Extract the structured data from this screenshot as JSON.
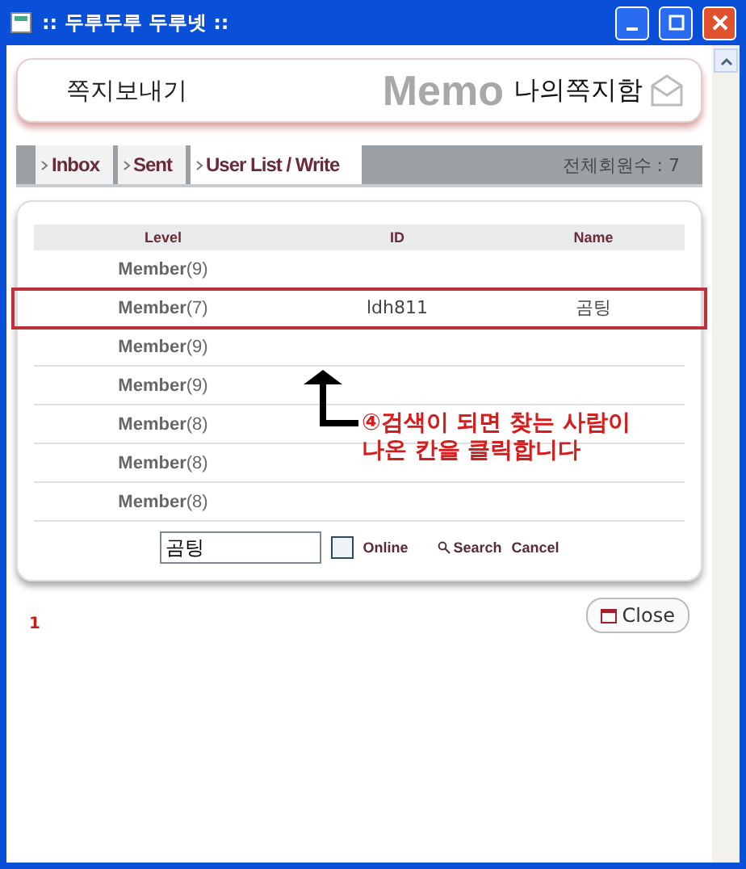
{
  "window": {
    "title": ":: 두루두루 두루넷 ::"
  },
  "header": {
    "left": "쪽지보내기",
    "right": "나의쪽지함",
    "logo": "Memo"
  },
  "tabs": [
    {
      "label": "Inbox",
      "selected": false
    },
    {
      "label": "Sent",
      "selected": false
    },
    {
      "label": "User List / Write",
      "selected": true
    }
  ],
  "member_count": "전체회원수 : 7",
  "table": {
    "columns": [
      "Level",
      "ID",
      "Name"
    ],
    "rows": [
      {
        "level": "Member",
        "num": "(9)",
        "id": "",
        "name": "",
        "selected": false
      },
      {
        "level": "Member",
        "num": "(7)",
        "id": "ldh811",
        "name": "곰팅",
        "selected": true
      },
      {
        "level": "Member",
        "num": "(9)",
        "id": "",
        "name": "",
        "selected": false
      },
      {
        "level": "Member",
        "num": "(9)",
        "id": "",
        "name": "",
        "selected": false
      },
      {
        "level": "Member",
        "num": "(8)",
        "id": "",
        "name": "",
        "selected": false
      },
      {
        "level": "Member",
        "num": "(8)",
        "id": "",
        "name": "",
        "selected": false
      },
      {
        "level": "Member",
        "num": "(8)",
        "id": "",
        "name": "",
        "selected": false
      }
    ]
  },
  "search": {
    "value": "곰팅",
    "online": {
      "label": "Online",
      "checked": false
    },
    "search_label": "Search",
    "cancel_label": "Cancel"
  },
  "pager": {
    "pages": [
      {
        "label": "1",
        "selected": true
      }
    ]
  },
  "close_label": "Close",
  "annotation": {
    "lines": [
      "④검색이 되면 찾는 사람이",
      "나온 칸을 클릭합니다"
    ]
  }
}
